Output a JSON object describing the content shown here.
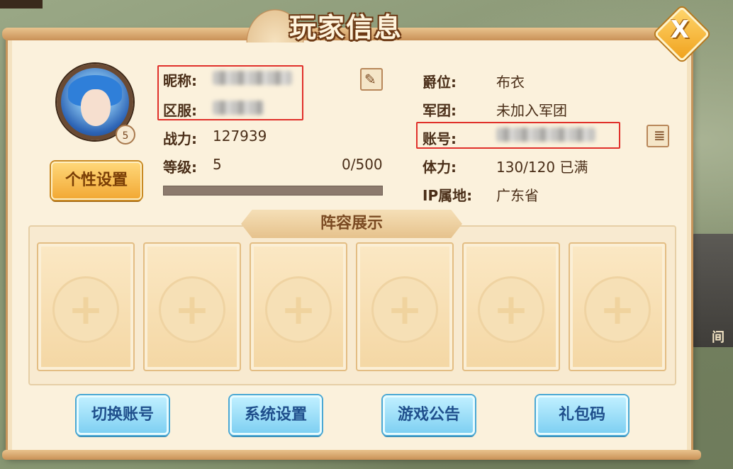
{
  "title": "玩家信息",
  "close_label": "X",
  "avatar_level": "5",
  "personal_settings_label": "个性设置",
  "left_info": {
    "nickname_label": "昵称:",
    "server_label": "区服:",
    "power_label": "战力:",
    "power_value": "127939",
    "level_label": "等级:",
    "level_value": "5",
    "exp_value": "0/500",
    "exp_fraction": 0
  },
  "right_info": {
    "rank_label": "爵位:",
    "rank_value": "布衣",
    "legion_label": "军团:",
    "legion_value": "未加入军团",
    "account_label": "账号:",
    "stamina_label": "体力:",
    "stamina_value": "130/120  已满",
    "ip_label": "IP属地:",
    "ip_value": "广东省"
  },
  "lineup_title": "阵容展示",
  "buttons": {
    "switch_account": "切换账号",
    "system_settings": "系统设置",
    "game_notice": "游戏公告",
    "gift_code": "礼包码"
  },
  "background_label": "间",
  "icons": {
    "edit": "pencil-icon",
    "copy": "notebook-icon",
    "slot": "plus-icon"
  },
  "colors": {
    "panel_bg": "#fbf1dc",
    "label_text": "#4a2e18",
    "orange_button": "#f2a935",
    "blue_button": "#7fd0f2",
    "highlight_box": "#e0302a"
  }
}
